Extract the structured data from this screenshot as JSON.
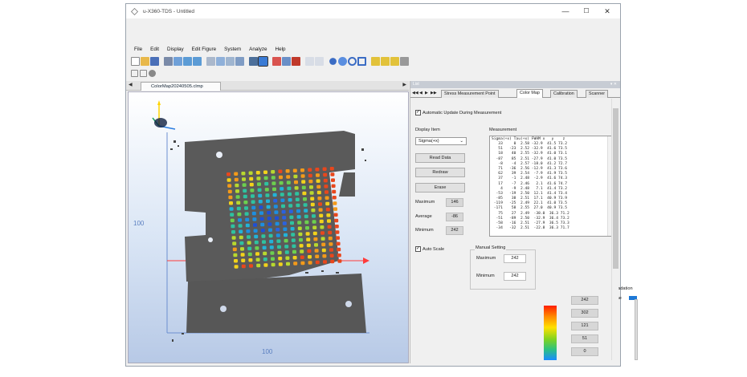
{
  "window": {
    "title": "u-X360-TDS - Untitled",
    "min": "—",
    "max": "☐",
    "close": "✕"
  },
  "menu": [
    "File",
    "Edit",
    "Display",
    "Edit Figure",
    "System",
    "Analyze",
    "Help"
  ],
  "doc_tab": {
    "label": "ColorMap20240505.clmp"
  },
  "viewport": {
    "y_axis_label": "100",
    "x_axis_label": "100"
  },
  "panel": {
    "header": "List",
    "nav": [
      "◀◀",
      "◀",
      "▶",
      "▶▶"
    ],
    "tabs": [
      "Stress Measurement Point",
      "Color Map",
      "Calibration",
      "Scanner"
    ],
    "auto_update": "Automatic Update During Measurement",
    "display_item_label": "Display Item",
    "display_item_value": "Sigma(+x)",
    "buttons": {
      "read_data": "Read Data",
      "redraw": "Redraw",
      "erase": "Erase"
    },
    "stats": [
      {
        "label": "Maximum",
        "value": "146"
      },
      {
        "label": "Average",
        "value": "-86"
      },
      {
        "label": "Minimum",
        "value": "242"
      }
    ],
    "measurement_label": "Measurement",
    "table_header": "Sigma(+x) Tau(+x) FWHM x   y    z",
    "table_rows": [
      "   33     0  2.58 -32.9  41.5 73.2",
      "   51   -23  2.52 -32.9  41.6 73.5",
      "   18    40  2.55 -32.9  41.0 73.1",
      "  -87    85  2.51 -27.9  41.0 73.5",
      "   -8    -4  2.57 -18.0  41.2 72.7",
      "   71   -36  2.56 -12.9  41.3 73.6",
      "   62    39  2.54  -7.9  41.9 73.5",
      "   37    -1  2.48  -2.9  41.6 74.3",
      "   17    -7  2.46   2.1  41.6 74.7",
      "    4    -9  2.48   7.1  41.4 73.2",
      "  -53   -19  2.50  12.1  41.4 73.4",
      "  -85    38  2.51  17.1  40.9 73.9",
      " -119   -25  2.49  22.1  41.0 73.5",
      " -171    58  2.55  27.0  40.9 73.5",
      "   75    27  2.49  -38.0  36.3 71.2",
      "  -51   -89  2.50  -32.9  36.4 73.2",
      "  -58   -16  2.51  -27.9  36.5 73.3",
      "  -34   -32  2.51  -22.8  36.3 71.7"
    ],
    "auto_scale": "Auto Scale",
    "manual_setting": "Manual Setting",
    "manual_max_label": "Maximum",
    "manual_max": "242",
    "manual_min_label": "Minimum",
    "manual_min": "242",
    "scale_values": [
      "242",
      "302",
      "121",
      "51",
      "0"
    ],
    "gradation_label": "Gradation",
    "fine_label": "Fine"
  }
}
